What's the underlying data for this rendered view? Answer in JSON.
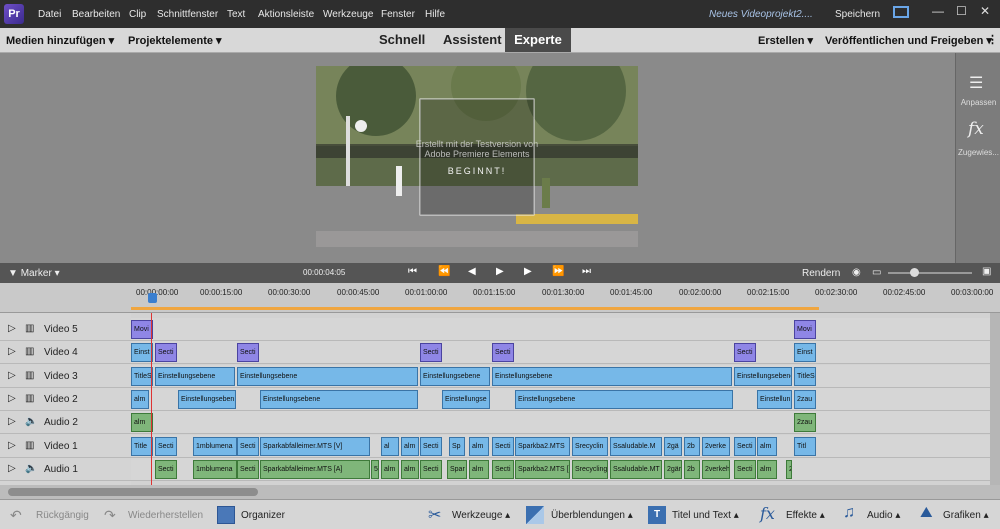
{
  "menubar": {
    "items": [
      "Datei",
      "Bearbeiten",
      "Clip",
      "Schnittfenster",
      "Text",
      "Aktionsleiste",
      "Werkzeuge",
      "Fenster",
      "Hilfe"
    ],
    "project_name": "Neues Videoprojekt2....",
    "save": "Speichern"
  },
  "toolbar": {
    "add_media": "Medien hinzufügen",
    "project_assets": "Projektelemente",
    "modes": [
      "Schnell",
      "Assistent",
      "Experte"
    ],
    "create": "Erstellen",
    "publish": "Veröffentlichen und Freigeben"
  },
  "rightpanel": {
    "adjust": "Anpassen",
    "effects_label": "Zugewies..."
  },
  "preview": {
    "watermark_line1": "Erstellt mit der Testversion von",
    "watermark_line2": "Adobe Premiere Elements",
    "title_text": "BEGINNT!"
  },
  "transport": {
    "marker": "Marker",
    "timecode": "00:00:04:05",
    "render": "Rendern"
  },
  "ruler": {
    "ticks": [
      "00:00:00:00",
      "00:00:15:00",
      "00:00:30:00",
      "00:00:45:00",
      "00:01:00:00",
      "00:01:15:00",
      "00:01:30:00",
      "00:01:45:00",
      "00:02:00:00",
      "00:02:15:00",
      "00:02:30:00",
      "00:02:45:00",
      "00:03:00:00"
    ]
  },
  "tracks": [
    {
      "name": "Video 5",
      "type": "video",
      "clips": [
        {
          "label": "Movi",
          "start": 0,
          "w": 22,
          "color": "purple"
        },
        {
          "label": "Movi",
          "start": 663,
          "w": 22,
          "color": "purple"
        }
      ]
    },
    {
      "name": "Video 4",
      "type": "video",
      "clips": [
        {
          "label": "Einst",
          "start": 0,
          "w": 22,
          "color": "blue"
        },
        {
          "label": "Secti",
          "start": 24,
          "w": 22,
          "color": "purple"
        },
        {
          "label": "Secti",
          "start": 106,
          "w": 22,
          "color": "purple"
        },
        {
          "label": "Secti",
          "start": 289,
          "w": 22,
          "color": "purple"
        },
        {
          "label": "Secti",
          "start": 361,
          "w": 22,
          "color": "purple"
        },
        {
          "label": "Secti",
          "start": 603,
          "w": 22,
          "color": "purple"
        },
        {
          "label": "Einst",
          "start": 663,
          "w": 22,
          "color": "blue"
        }
      ]
    },
    {
      "name": "Video 3",
      "type": "video",
      "clips": [
        {
          "label": "TitleS",
          "start": 0,
          "w": 22,
          "color": "blue"
        },
        {
          "label": "Einstellungsebene",
          "start": 24,
          "w": 80,
          "color": "blue"
        },
        {
          "label": "Einstellungsebene",
          "start": 106,
          "w": 181,
          "color": "blue"
        },
        {
          "label": "Einstellungsebene",
          "start": 289,
          "w": 70,
          "color": "blue"
        },
        {
          "label": "Einstellungsebene",
          "start": 361,
          "w": 240,
          "color": "blue"
        },
        {
          "label": "Einstellungsebene",
          "start": 603,
          "w": 58,
          "color": "blue"
        },
        {
          "label": "TitleS",
          "start": 663,
          "w": 22,
          "color": "blue"
        }
      ]
    },
    {
      "name": "Video 2",
      "type": "video",
      "clips": [
        {
          "label": "alm",
          "start": 0,
          "w": 18,
          "color": "blue"
        },
        {
          "label": "Einstellungseben",
          "start": 47,
          "w": 58,
          "color": "blue"
        },
        {
          "label": "Einstellungsebene",
          "start": 129,
          "w": 158,
          "color": "blue"
        },
        {
          "label": "Einstellungse",
          "start": 311,
          "w": 48,
          "color": "blue"
        },
        {
          "label": "Einstellungsebene",
          "start": 384,
          "w": 218,
          "color": "blue"
        },
        {
          "label": "Einstellun",
          "start": 626,
          "w": 35,
          "color": "blue"
        },
        {
          "label": "2zau",
          "start": 663,
          "w": 22,
          "color": "blue"
        }
      ]
    },
    {
      "name": "Audio 2",
      "type": "audio",
      "clips": [
        {
          "label": "alm",
          "start": 0,
          "w": 22,
          "color": "green"
        },
        {
          "label": "2zau",
          "start": 663,
          "w": 22,
          "color": "green"
        }
      ]
    },
    {
      "name": "Video 1",
      "type": "video",
      "clips": [
        {
          "label": "Title",
          "start": 0,
          "w": 22,
          "color": "blue"
        },
        {
          "label": "Secti",
          "start": 24,
          "w": 22,
          "color": "blue"
        },
        {
          "label": "1mblumena",
          "start": 62,
          "w": 44,
          "color": "blue"
        },
        {
          "label": "Secti",
          "start": 106,
          "w": 22,
          "color": "blue"
        },
        {
          "label": "Sparkabfalleimer.MTS [V]",
          "start": 129,
          "w": 110,
          "color": "blue"
        },
        {
          "label": "al",
          "start": 250,
          "w": 18,
          "color": "blue"
        },
        {
          "label": "alm",
          "start": 270,
          "w": 18,
          "color": "blue"
        },
        {
          "label": "Secti",
          "start": 289,
          "w": 22,
          "color": "blue"
        },
        {
          "label": "Sp",
          "start": 318,
          "w": 16,
          "color": "blue"
        },
        {
          "label": "alm",
          "start": 338,
          "w": 20,
          "color": "blue"
        },
        {
          "label": "Secti",
          "start": 361,
          "w": 22,
          "color": "blue"
        },
        {
          "label": "Sparkba2.MTS",
          "start": 384,
          "w": 55,
          "color": "blue"
        },
        {
          "label": "Srecyclin",
          "start": 441,
          "w": 36,
          "color": "blue"
        },
        {
          "label": "Ssaludable.M",
          "start": 479,
          "w": 52,
          "color": "blue"
        },
        {
          "label": "2gä",
          "start": 533,
          "w": 18,
          "color": "blue"
        },
        {
          "label": "2b",
          "start": 553,
          "w": 16,
          "color": "blue"
        },
        {
          "label": "2verke",
          "start": 571,
          "w": 28,
          "color": "blue"
        },
        {
          "label": "Secti",
          "start": 603,
          "w": 22,
          "color": "blue"
        },
        {
          "label": "alm",
          "start": 626,
          "w": 20,
          "color": "blue"
        },
        {
          "label": "Titl",
          "start": 663,
          "w": 22,
          "color": "blue"
        }
      ]
    },
    {
      "name": "Audio 1",
      "type": "audio",
      "clips": [
        {
          "label": "Secti",
          "start": 24,
          "w": 22,
          "color": "green"
        },
        {
          "label": "1mblumena",
          "start": 62,
          "w": 44,
          "color": "green"
        },
        {
          "label": "Secti",
          "start": 106,
          "w": 22,
          "color": "green"
        },
        {
          "label": "Sparkabfalleimer.MTS [A]",
          "start": 129,
          "w": 110,
          "color": "green"
        },
        {
          "label": "5",
          "start": 240,
          "w": 8,
          "color": "green"
        },
        {
          "label": "alm",
          "start": 250,
          "w": 18,
          "color": "green"
        },
        {
          "label": "alm",
          "start": 270,
          "w": 18,
          "color": "green"
        },
        {
          "label": "Secti",
          "start": 289,
          "w": 22,
          "color": "green"
        },
        {
          "label": "Spar",
          "start": 316,
          "w": 20,
          "color": "green"
        },
        {
          "label": "alm",
          "start": 338,
          "w": 20,
          "color": "green"
        },
        {
          "label": "Secti",
          "start": 361,
          "w": 22,
          "color": "green"
        },
        {
          "label": "Sparkba2.MTS [",
          "start": 384,
          "w": 55,
          "color": "green"
        },
        {
          "label": "Srecycling",
          "start": 441,
          "w": 36,
          "color": "green"
        },
        {
          "label": "Ssaludable.MT",
          "start": 479,
          "w": 52,
          "color": "green"
        },
        {
          "label": "2gärt",
          "start": 533,
          "w": 18,
          "color": "green"
        },
        {
          "label": "2b",
          "start": 553,
          "w": 16,
          "color": "green"
        },
        {
          "label": "2verkehr",
          "start": 571,
          "w": 28,
          "color": "green"
        },
        {
          "label": "Secti",
          "start": 603,
          "w": 22,
          "color": "green"
        },
        {
          "label": "alm",
          "start": 626,
          "w": 20,
          "color": "green"
        },
        {
          "label": "2",
          "start": 655,
          "w": 6,
          "color": "green"
        }
      ]
    }
  ],
  "bottombar": {
    "undo": "Rückgängig",
    "redo": "Wiederherstellen",
    "organizer": "Organizer",
    "tools": "Werkzeuge",
    "transitions": "Überblendungen",
    "titles": "Titel und Text",
    "effects": "Effekte",
    "audio": "Audio",
    "graphics": "Grafiken"
  }
}
